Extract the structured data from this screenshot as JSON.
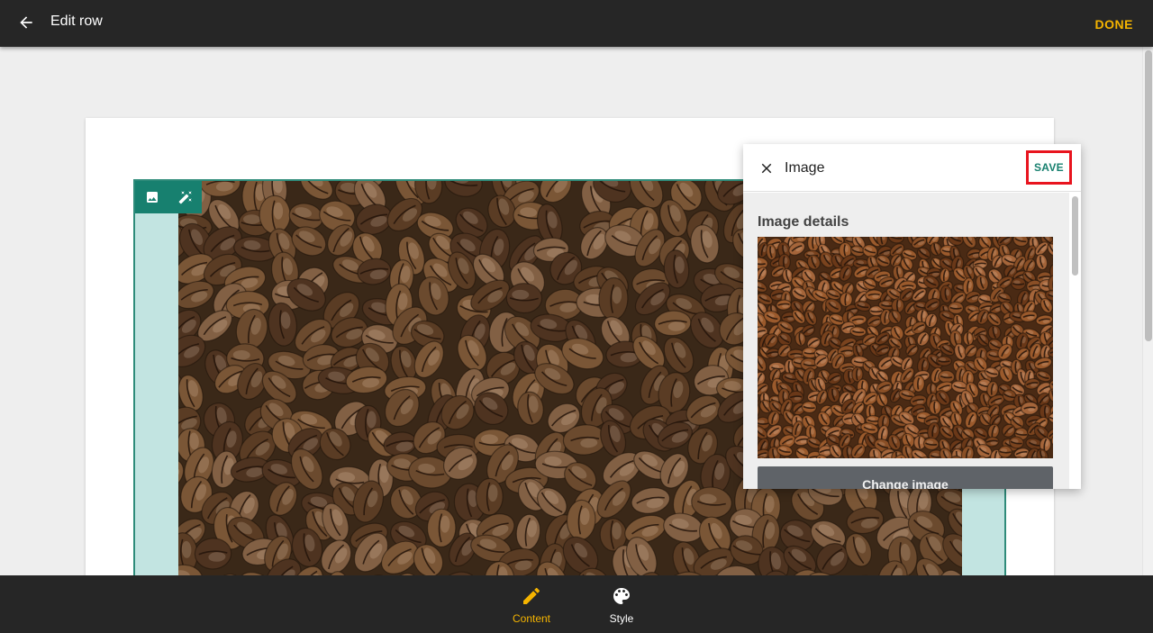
{
  "header": {
    "title": "Edit row",
    "done_label": "DONE"
  },
  "panel": {
    "title": "Image",
    "save_label": "SAVE",
    "section_title": "Image details",
    "change_image_label": "Change image"
  },
  "bottom_nav": {
    "tabs": [
      {
        "label": "Content",
        "icon": "pencil-icon",
        "active": true
      },
      {
        "label": "Style",
        "icon": "palette-icon",
        "active": false
      }
    ]
  },
  "colors": {
    "accent": "#f5b400",
    "teal": "#17806f",
    "highlight_border": "#e8141e",
    "bar_background": "#262626"
  }
}
